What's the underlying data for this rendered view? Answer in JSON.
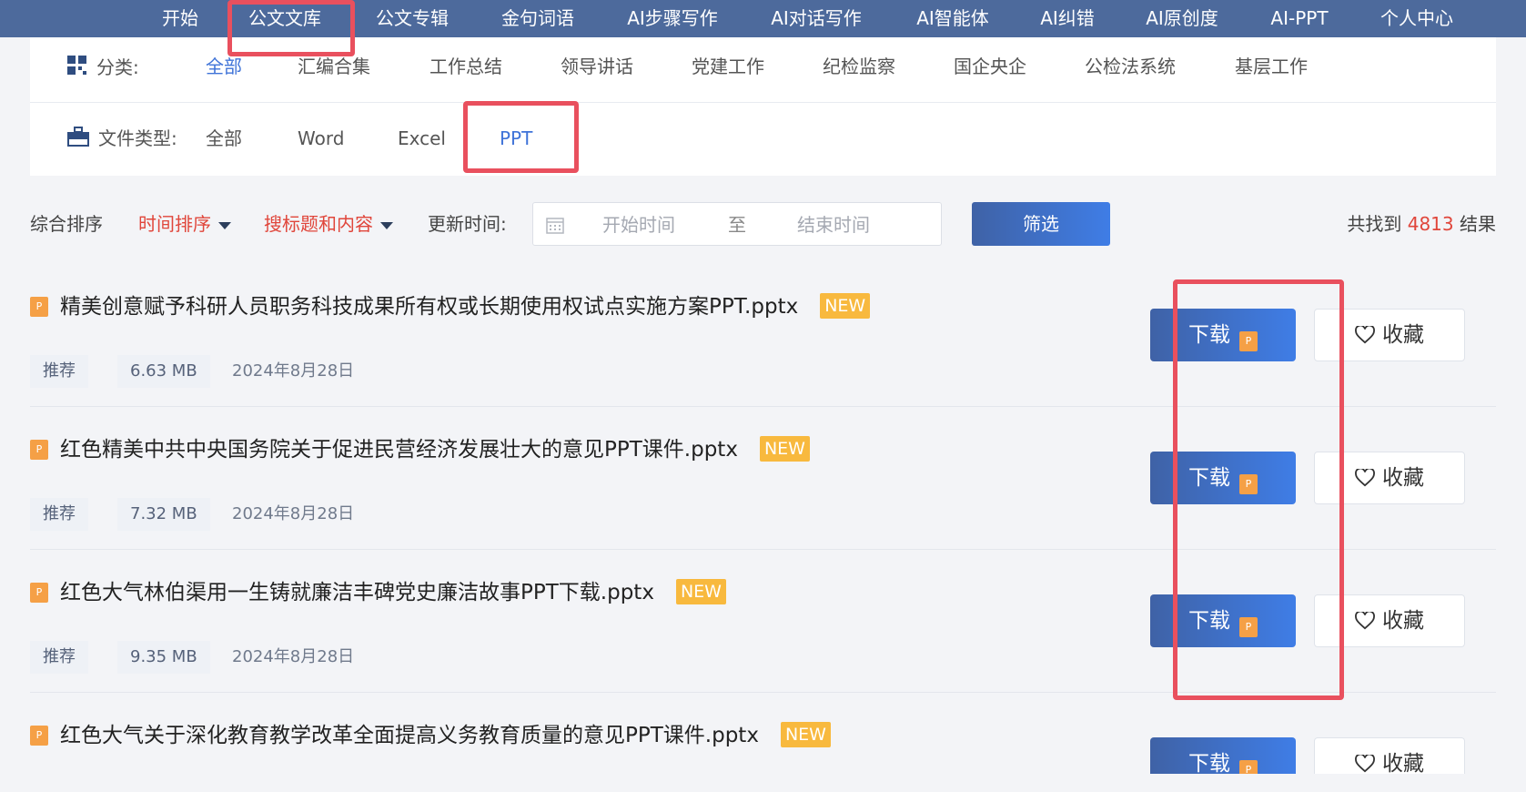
{
  "nav": {
    "items": [
      "开始",
      "公文文库",
      "公文专辑",
      "金句词语",
      "AI步骤写作",
      "AI对话写作",
      "AI智能体",
      "AI纠错",
      "AI原创度",
      "AI-PPT",
      "个人中心"
    ]
  },
  "filters": {
    "category_label": "分类:",
    "categories": [
      "全部",
      "汇编合集",
      "工作总结",
      "领导讲话",
      "党建工作",
      "纪检监察",
      "国企央企",
      "公检法系统",
      "基层工作"
    ],
    "filetype_label": "文件类型:",
    "filetypes": [
      "全部",
      "Word",
      "Excel",
      "PPT"
    ]
  },
  "sortbar": {
    "general": "综合排序",
    "time": "时间排序",
    "search_scope": "搜标题和内容",
    "update_label": "更新时间:",
    "start_placeholder": "开始时间",
    "to": "至",
    "end_placeholder": "结束时间",
    "filter_button": "筛选",
    "result_prefix": "共找到",
    "result_count": "4813",
    "result_suffix": "结果"
  },
  "results": [
    {
      "title": "精美创意赋予科研人员职务科技成果所有权或长期使用权试点实施方案PPT.pptx",
      "badge": "NEW",
      "tag": "推荐",
      "size": "6.63 MB",
      "date": "2024年8月28日"
    },
    {
      "title": "红色精美中共中央国务院关于促进民营经济发展壮大的意见PPT课件.pptx",
      "badge": "NEW",
      "tag": "推荐",
      "size": "7.32 MB",
      "date": "2024年8月28日"
    },
    {
      "title": "红色大气林伯渠用一生铸就廉洁丰碑党史廉洁故事PPT下载.pptx",
      "badge": "NEW",
      "tag": "推荐",
      "size": "9.35 MB",
      "date": "2024年8月28日"
    },
    {
      "title": "红色大气关于深化教育教学改革全面提高义务教育质量的意见PPT课件.pptx",
      "badge": "NEW",
      "tag": "",
      "size": "",
      "date": ""
    }
  ],
  "actions": {
    "download": "下载",
    "favorite": "收藏",
    "file_icon_letter": "P"
  },
  "colors": {
    "nav_bg": "#4d6a9c",
    "accent_blue": "#3f73d8",
    "accent_red": "#e0463b",
    "highlight": "#e9505e",
    "badge": "#f8b93e",
    "file_icon": "#f5a046"
  }
}
